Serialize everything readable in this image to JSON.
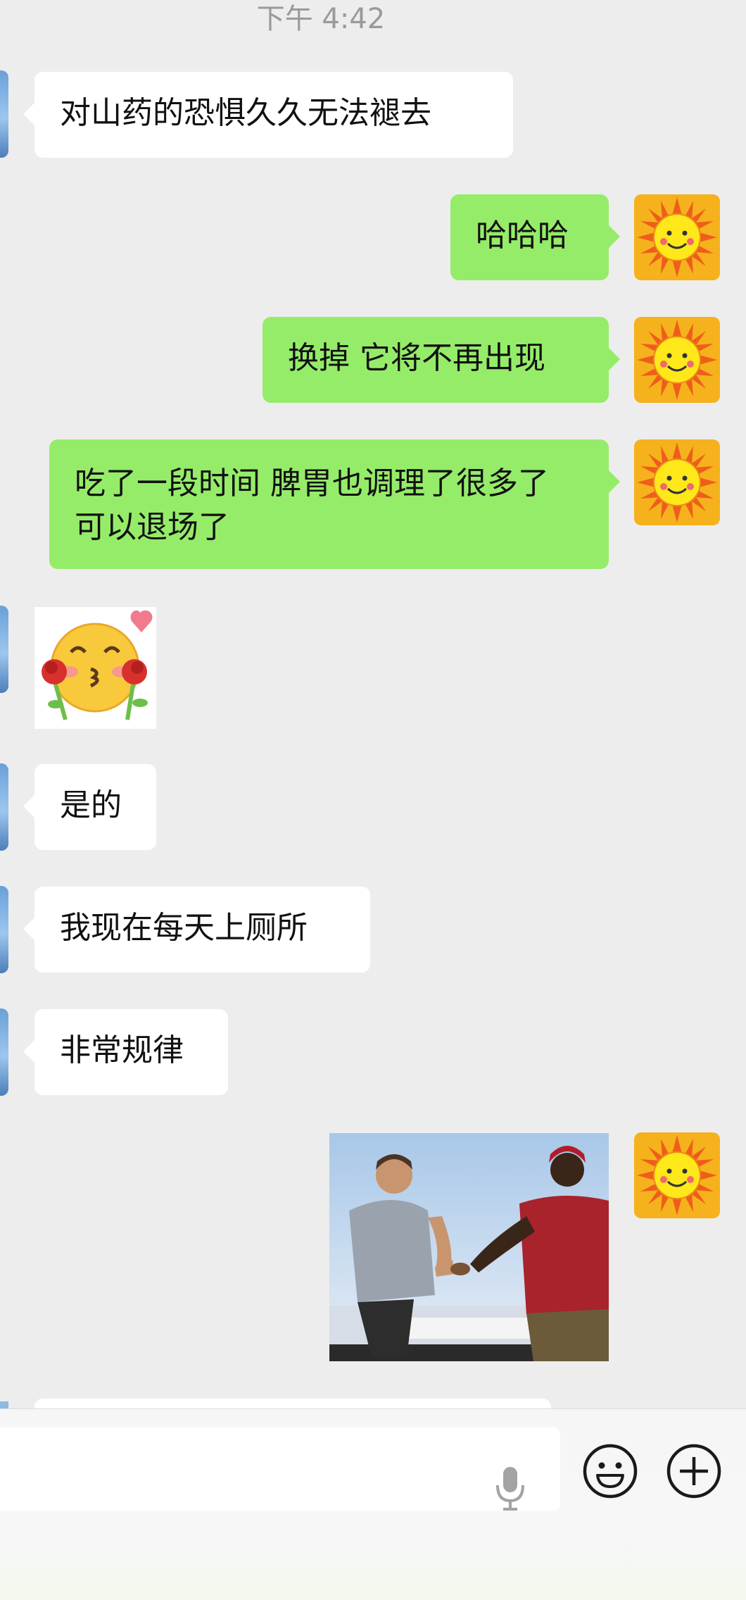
{
  "status": {
    "timestamp": "下午 4:42"
  },
  "messages": [
    {
      "side": "left",
      "type": "text",
      "text": "对山药的恐惧久久无法褪去"
    },
    {
      "side": "right",
      "type": "text",
      "text": "哈哈哈"
    },
    {
      "side": "right",
      "type": "text",
      "text": "换掉 它将不再出现"
    },
    {
      "side": "right",
      "type": "text",
      "text": "吃了一段时间 脾胃也调理了很多了 可以退场了"
    },
    {
      "side": "left",
      "type": "sticker",
      "sticker": "blushing-face-with-roses"
    },
    {
      "side": "left",
      "type": "text",
      "text": "是的"
    },
    {
      "side": "left",
      "type": "text",
      "text": "我现在每天上厕所"
    },
    {
      "side": "left",
      "type": "text",
      "text": "非常规律"
    },
    {
      "side": "right",
      "type": "image",
      "image": "handshake-photo"
    }
  ],
  "input_bar": {
    "icons": [
      "microphone-icon",
      "emoji-icon",
      "plus-icon"
    ]
  },
  "colors": {
    "background": "#ededed",
    "outgoing_bubble": "#95ec69",
    "incoming_bubble": "#ffffff",
    "avatar": "#f6b21c"
  }
}
